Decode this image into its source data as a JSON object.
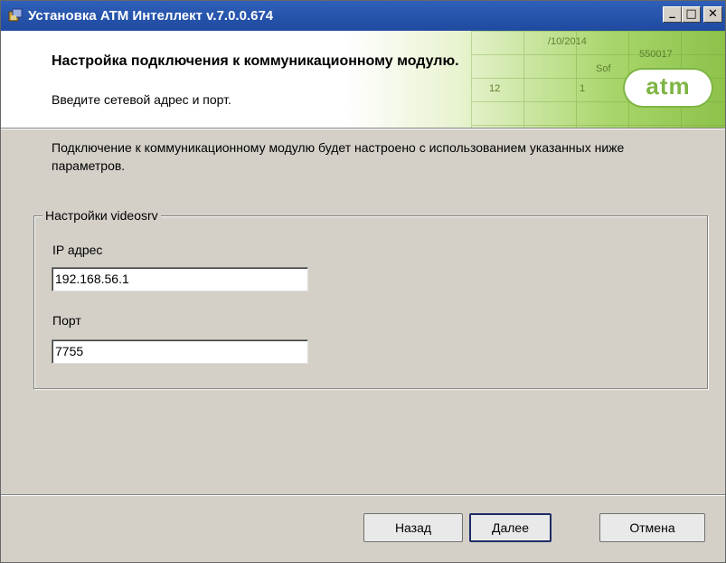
{
  "window": {
    "title": "Установка ATM Интеллект v.7.0.0.674",
    "minimize_glyph": "_",
    "maximize_glyph": "□",
    "close_glyph": "✕"
  },
  "header": {
    "title": "Настройка подключения к коммуникационному модулю.",
    "subtitle": "Введите сетевой адрес и порт.",
    "logo_text": "atm",
    "bg_fragments": [
      "/10/2014",
      "550017",
      "Sof",
      "1",
      "12"
    ]
  },
  "body": {
    "description": "Подключение к коммуникационному модулю будет настроено с использованием указанных ниже параметров.",
    "group_title": "Настройки videosrv",
    "ip_label": "IP адрес",
    "ip_value": "192.168.56.1",
    "port_label": "Порт",
    "port_value": "7755"
  },
  "buttons": {
    "back": "Назад",
    "next": "Далее",
    "cancel": "Отмена"
  },
  "colors": {
    "titlebar": "#1f4aa0",
    "accent_green": "#7eb544",
    "dialog_bg": "#d4d0c8"
  }
}
